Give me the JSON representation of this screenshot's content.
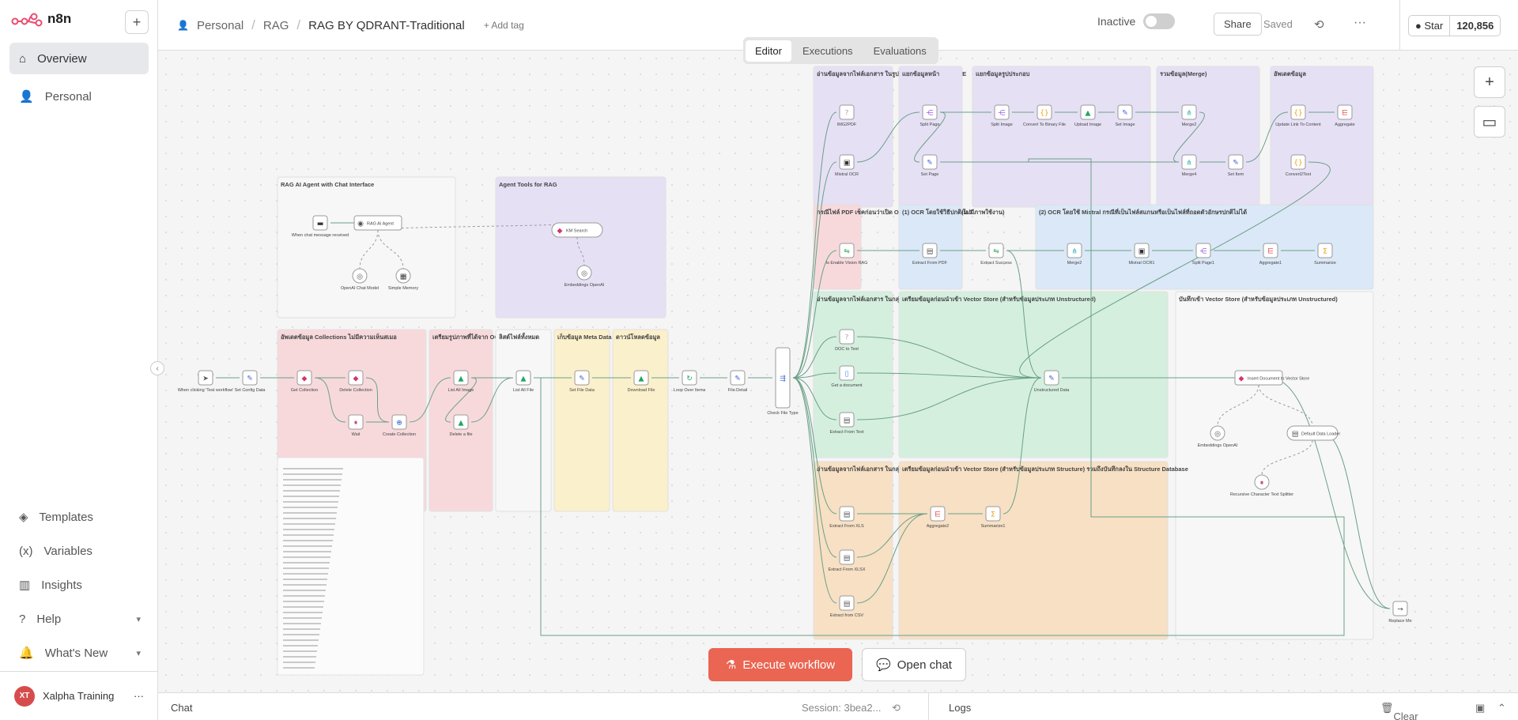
{
  "app": {
    "name": "n8n"
  },
  "sidebar": {
    "nav": [
      {
        "label": "Overview",
        "active": true
      },
      {
        "label": "Personal",
        "active": false
      }
    ],
    "bottom": [
      {
        "label": "Templates"
      },
      {
        "label": "Variables"
      },
      {
        "label": "Insights"
      },
      {
        "label": "Help"
      },
      {
        "label": "What's New"
      }
    ],
    "user": {
      "initials": "XT",
      "name": "Xalpha Training"
    }
  },
  "header": {
    "breadcrumb": [
      "Personal",
      "RAG"
    ],
    "workflow_name": "RAG BY QDRANT-Traditional",
    "add_tag": "+ Add tag",
    "status": "Inactive",
    "share": "Share",
    "saved": "Saved",
    "star": "Star",
    "star_count": "120,856"
  },
  "tabs": [
    "Editor",
    "Executions",
    "Evaluations"
  ],
  "actions": {
    "execute": "Execute workflow",
    "open_chat": "Open chat"
  },
  "bottom_bar": {
    "chat": "Chat",
    "session": "Session: 3bea2...",
    "logs": "Logs",
    "clear": "Clear execution"
  },
  "colors": {
    "accent": "#ea6552",
    "purple": "#e6e0f5",
    "pink": "#f7d9dc",
    "blue": "#dbe8f7",
    "green": "#d5efdf",
    "orange": "#f7e0c4",
    "yellow": "#fbf0cc",
    "edge": "#6aa087"
  },
  "workflow": {
    "sticky_notes": [
      {
        "title": "RAG AI Agent with Chat Interface",
        "color": "white"
      },
      {
        "title": "Agent Tools for RAG",
        "color": "purple"
      },
      {
        "title": "อัพเดตข้อมูล Collections ไม่มีความเห็นสเมอ",
        "color": "pink"
      },
      {
        "title": "เตรียมรูปภาพที่ได้จาก OCR ทั้งหมด",
        "color": "pink"
      },
      {
        "title": "ลิสต์ไฟล์ทั้งหมด",
        "color": "white"
      },
      {
        "title": "เก็บข้อมูล Meta Data",
        "color": "yellow"
      },
      {
        "title": "ดาวน์โหลดข้อมูล",
        "color": "yellow"
      },
      {
        "title": "อ่านข้อมูลจากไฟล์เอกสาร ในรูปแบบ VISION OCR MODE",
        "color": "purple"
      },
      {
        "title": "แยกข้อมูลหน้า",
        "color": "purple"
      },
      {
        "title": "แยกข้อมูลรูปประกอบ",
        "color": "purple"
      },
      {
        "title": "รวมข้อมูล(Merge)",
        "color": "purple"
      },
      {
        "title": "อัพเดตข้อมูล",
        "color": "purple"
      },
      {
        "title": "กรณีไฟล์ PDF เช็คก่อนว่าเปิด OCR VISION MODE ไว้ไหม ?",
        "color": "pink"
      },
      {
        "title": "(1) OCR โดยใช้วิธีปกติ(ไม่มีภาพใช้งาน)",
        "color": "blue"
      },
      {
        "title": "(2) OCR โดยใช้ Mistral กรณีที่เป็นไฟล์สแกนหรือเป็นไฟล์ที่ถอดตัวอักษรปกติไม่ได้",
        "color": "blue"
      },
      {
        "title": "อ่านข้อมูลจากไฟล์เอกสาร ในกลุ่มประเภท Text",
        "color": "green"
      },
      {
        "title": "เตรียมข้อมูลก่อนนำเข้า Vector Store (สำหรับข้อมูลประเภท Unstructured)",
        "color": "green"
      },
      {
        "title": "บันทึกเข้า Vector Store (สำหรับข้อมูลประเภท Unstructured)",
        "color": "white"
      },
      {
        "title": "อ่านข้อมูลจากไฟล์เอกสาร ในกลุ่มประเภท Sheet",
        "color": "orange"
      },
      {
        "title": "เตรียมข้อมูลก่อนนำเข้า Vector Store (สำหรับข้อมูลประเภท Structure) รวมถึงบันทึกลงใน Structure Database",
        "color": "orange"
      }
    ],
    "nodes": [
      {
        "id": "trigger",
        "label": "When clicking 'Test workflow'",
        "icon": "cursor-icon"
      },
      {
        "id": "config",
        "label": "Set Config Data",
        "icon": "pen-icon"
      },
      {
        "id": "getcol",
        "label": "Get Collection",
        "icon": "qdrant-icon"
      },
      {
        "id": "delcol",
        "label": "Delete Collection",
        "icon": "qdrant-icon"
      },
      {
        "id": "wait",
        "label": "Wait",
        "icon": "pause-icon"
      },
      {
        "id": "createcol",
        "label": "Create Collection",
        "icon": "globe-icon"
      },
      {
        "id": "listimg",
        "label": "List All Image",
        "icon": "drive-icon"
      },
      {
        "id": "delfile",
        "label": "Delete a file",
        "icon": "drive-icon"
      },
      {
        "id": "listall",
        "label": "List All File",
        "icon": "drive-icon"
      },
      {
        "id": "setfile",
        "label": "Set File Data",
        "icon": "pen-icon"
      },
      {
        "id": "download",
        "label": "Download File",
        "icon": "drive-icon"
      },
      {
        "id": "loop",
        "label": "Loop Over Items",
        "icon": "loop-icon"
      },
      {
        "id": "filedetail",
        "label": "File Detail",
        "icon": "pen-icon"
      },
      {
        "id": "checktype",
        "label": "Check File Type",
        "icon": "switch-icon"
      },
      {
        "id": "chattrig",
        "label": "When chat message received",
        "icon": "chat-icon"
      },
      {
        "id": "agent",
        "label": "RAG AI Agent",
        "icon": "robot-icon"
      },
      {
        "id": "openai",
        "label": "OpenAI Chat Model",
        "icon": "openai-icon"
      },
      {
        "id": "memory",
        "label": "Simple Memory",
        "icon": "memory-icon"
      },
      {
        "id": "kbsearch",
        "label": "KM Search",
        "icon": "qdrant-icon"
      },
      {
        "id": "embed1",
        "label": "Embeddings OpenAI",
        "icon": "openai-icon"
      },
      {
        "id": "img2pdf",
        "label": "IMG2PDF",
        "icon": "unknown-icon"
      },
      {
        "id": "mistralocr",
        "label": "Mistral OCR",
        "icon": "terminal-icon"
      },
      {
        "id": "splitpage",
        "label": "Split Page",
        "icon": "split-icon"
      },
      {
        "id": "setpage",
        "label": "Set Page",
        "icon": "pen-icon"
      },
      {
        "id": "splitimage",
        "label": "Split Image",
        "icon": "split-icon"
      },
      {
        "id": "convbin",
        "label": "Convert To Binary File",
        "icon": "code-icon"
      },
      {
        "id": "uploadimg",
        "label": "Upload Image",
        "icon": "drive-icon"
      },
      {
        "id": "setimage",
        "label": "Set Image",
        "icon": "pen-icon"
      },
      {
        "id": "merge2",
        "label": "Merge2",
        "icon": "merge-icon"
      },
      {
        "id": "merge4",
        "label": "Merge4",
        "icon": "merge-icon"
      },
      {
        "id": "setitem",
        "label": "Set Item",
        "icon": "pen-icon"
      },
      {
        "id": "updlink",
        "label": "Update Link To Content",
        "icon": "code-icon"
      },
      {
        "id": "aggregate",
        "label": "Aggregate",
        "icon": "aggregate-icon"
      },
      {
        "id": "convtext",
        "label": "Convert2Text",
        "icon": "code-icon"
      },
      {
        "id": "isvision",
        "label": "Is Enable Vision RAG",
        "icon": "if-icon"
      },
      {
        "id": "extpdf",
        "label": "Extract From PDF",
        "icon": "file-icon"
      },
      {
        "id": "extsuccess",
        "label": "Extract Success",
        "icon": "if-icon"
      },
      {
        "id": "merge2b",
        "label": "Merge2",
        "icon": "merge-icon"
      },
      {
        "id": "mistralocr1",
        "label": "Mistral OCR1",
        "icon": "terminal-icon"
      },
      {
        "id": "splitpage1",
        "label": "Split Page1",
        "icon": "split-icon"
      },
      {
        "id": "aggregate1",
        "label": "Aggregate1",
        "icon": "aggregate-icon"
      },
      {
        "id": "summarize",
        "label": "Summarize",
        "icon": "sum-icon"
      },
      {
        "id": "doc2text",
        "label": "DOC to Text",
        "icon": "unknown-icon"
      },
      {
        "id": "getdoc",
        "label": "Get a document",
        "icon": "docs-icon"
      },
      {
        "id": "exttext",
        "label": "Extract From Text",
        "icon": "file-icon"
      },
      {
        "id": "unstruct",
        "label": "Unstructured Data",
        "icon": "pen-icon"
      },
      {
        "id": "insert",
        "label": "Insert Document to Vector Store",
        "icon": "qdrant-icon"
      },
      {
        "id": "embed2",
        "label": "Embeddings OpenAI",
        "icon": "openai-icon"
      },
      {
        "id": "loader",
        "label": "Default Data Loader",
        "icon": "doc-icon"
      },
      {
        "id": "splitter",
        "label": "Recursive Character Text Splitter",
        "icon": "pause-icon"
      },
      {
        "id": "extxls",
        "label": "Extract From XLS",
        "icon": "file-icon"
      },
      {
        "id": "extxlsx",
        "label": "Extract From XLSX",
        "icon": "file-icon"
      },
      {
        "id": "extcsv",
        "label": "Extract from CSV",
        "icon": "file-icon"
      },
      {
        "id": "aggregate2",
        "label": "Aggregate2",
        "icon": "aggregate-icon"
      },
      {
        "id": "summarize1",
        "label": "Summarize1",
        "icon": "sum-icon"
      },
      {
        "id": "replace",
        "label": "Replace Me",
        "icon": "arrow-icon"
      }
    ]
  }
}
